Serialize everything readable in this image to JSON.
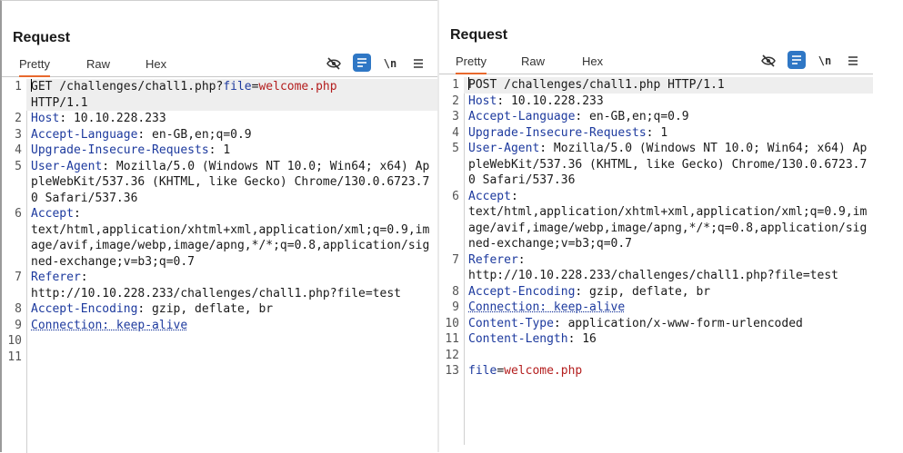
{
  "left": {
    "title": "Request",
    "tabs": [
      "Pretty",
      "Raw",
      "Hex"
    ],
    "lines": [
      {
        "n": "1",
        "parts": [
          [
            "GET /challenges/chall1.php?",
            ""
          ],
          [
            "file",
            "k"
          ],
          [
            "=",
            ""
          ],
          [
            "welcome.php",
            "v"
          ],
          [
            "\nHTTP/1.1",
            ""
          ]
        ],
        "hl": true,
        "cursor": true
      },
      {
        "n": "2",
        "parts": [
          [
            "Host",
            "k"
          ],
          [
            ": 10.10.228.233",
            ""
          ]
        ]
      },
      {
        "n": "3",
        "parts": [
          [
            "Accept-Language",
            "k"
          ],
          [
            ": en-GB,en;q=0.9",
            ""
          ]
        ]
      },
      {
        "n": "4",
        "parts": [
          [
            "Upgrade-Insecure-Requests",
            "k"
          ],
          [
            ": 1",
            ""
          ]
        ]
      },
      {
        "n": "5",
        "parts": [
          [
            "User-Agent",
            "k"
          ],
          [
            ": Mozilla/5.0 (Windows NT 10.0; Win64; x64) AppleWebKit/537.36 (KHTML, like Gecko) Chrome/130.0.6723.70 Safari/537.36",
            ""
          ]
        ]
      },
      {
        "n": "6",
        "parts": [
          [
            "Accept",
            "k"
          ],
          [
            ":\ntext/html,application/xhtml+xml,application/xml;q=0.9,image/avif,image/webp,image/apng,*/*;q=0.8,application/signed-exchange;v=b3;q=0.7",
            ""
          ]
        ]
      },
      {
        "n": "7",
        "parts": [
          [
            "Referer",
            "k"
          ],
          [
            ":\nhttp://10.10.228.233/challenges/chall1.php?file=test",
            ""
          ]
        ]
      },
      {
        "n": "8",
        "parts": [
          [
            "Accept-Encoding",
            "k"
          ],
          [
            ": gzip, deflate, br",
            ""
          ]
        ]
      },
      {
        "n": "9",
        "parts": [
          [
            "Connection: keep-alive",
            "conn"
          ]
        ]
      },
      {
        "n": "10",
        "parts": []
      },
      {
        "n": "11",
        "parts": []
      }
    ]
  },
  "right": {
    "title": "Request",
    "tabs": [
      "Pretty",
      "Raw",
      "Hex"
    ],
    "lines": [
      {
        "n": "1",
        "parts": [
          [
            "POST /challenges/chall1.php HTTP/1.1",
            ""
          ]
        ],
        "hl": true,
        "cursor": true
      },
      {
        "n": "2",
        "parts": [
          [
            "Host",
            "k"
          ],
          [
            ": 10.10.228.233",
            ""
          ]
        ]
      },
      {
        "n": "3",
        "parts": [
          [
            "Accept-Language",
            "k"
          ],
          [
            ": en-GB,en;q=0.9",
            ""
          ]
        ]
      },
      {
        "n": "4",
        "parts": [
          [
            "Upgrade-Insecure-Requests",
            "k"
          ],
          [
            ": 1",
            ""
          ]
        ]
      },
      {
        "n": "5",
        "parts": [
          [
            "User-Agent",
            "k"
          ],
          [
            ": Mozilla/5.0 (Windows NT 10.0; Win64; x64) AppleWebKit/537.36 (KHTML, like Gecko) Chrome/130.0.6723.70 Safari/537.36",
            ""
          ]
        ]
      },
      {
        "n": "6",
        "parts": [
          [
            "Accept",
            "k"
          ],
          [
            ":\ntext/html,application/xhtml+xml,application/xml;q=0.9,image/avif,image/webp,image/apng,*/*;q=0.8,application/signed-exchange;v=b3;q=0.7",
            ""
          ]
        ]
      },
      {
        "n": "7",
        "parts": [
          [
            "Referer",
            "k"
          ],
          [
            ":\nhttp://10.10.228.233/challenges/chall1.php?file=test",
            ""
          ]
        ]
      },
      {
        "n": "8",
        "parts": [
          [
            "Accept-Encoding",
            "k"
          ],
          [
            ": gzip, deflate, br",
            ""
          ]
        ]
      },
      {
        "n": "9",
        "parts": [
          [
            "Connection: keep-alive",
            "conn"
          ]
        ]
      },
      {
        "n": "10",
        "parts": [
          [
            "Content-Type",
            "k"
          ],
          [
            ": application/x-www-form-urlencoded",
            ""
          ]
        ]
      },
      {
        "n": "11",
        "parts": [
          [
            "Content-Length",
            "k"
          ],
          [
            ": 16",
            ""
          ]
        ]
      },
      {
        "n": "12",
        "parts": []
      },
      {
        "n": "13",
        "parts": [
          [
            "file",
            "k"
          ],
          [
            "=",
            ""
          ],
          [
            "welcome.php",
            "v"
          ]
        ]
      }
    ]
  },
  "toolbar": {
    "icons": [
      "eye-slash-icon",
      "format-icon",
      "newline-icon",
      "menu-icon"
    ],
    "newline_label": "\\n",
    "accent": "#2f77c5",
    "tab_underline": "#e8692e"
  }
}
